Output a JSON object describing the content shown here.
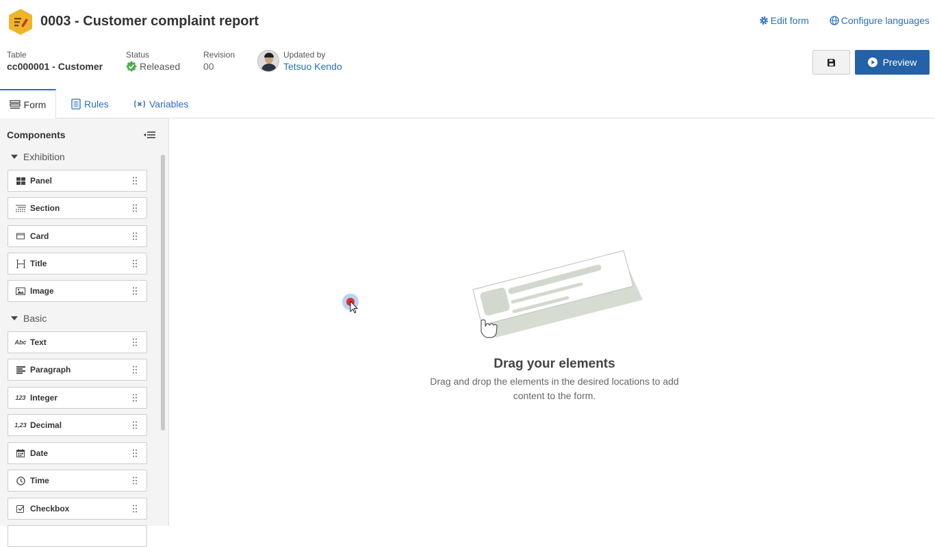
{
  "header": {
    "title": "0003 - Customer complaint report",
    "links": {
      "edit_form": "Edit form",
      "configure_languages": "Configure languages"
    },
    "meta": {
      "table_label": "Table",
      "table_value": "cc000001 - Customer",
      "status_label": "Status",
      "status_value": "Released",
      "revision_label": "Revision",
      "revision_value": "00",
      "updated_label": "Updated by",
      "updated_value": "Tetsuo Kendo"
    },
    "preview_label": "Preview",
    "colors": {
      "accent": "#2361a8",
      "status": "#4caf50",
      "app_icon": "#f0b429"
    }
  },
  "tabs": [
    {
      "label": "Form",
      "icon": "form-icon",
      "active": true
    },
    {
      "label": "Rules",
      "icon": "rules-icon"
    },
    {
      "label": "Variables",
      "icon": "variables-icon"
    }
  ],
  "sidebar": {
    "title": "Components",
    "groups": [
      {
        "label": "Exhibition",
        "items": [
          {
            "label": "Panel",
            "icon": "panel-icon"
          },
          {
            "label": "Section",
            "icon": "section-icon"
          },
          {
            "label": "Card",
            "icon": "card-icon"
          },
          {
            "label": "Title",
            "icon": "title-icon"
          },
          {
            "label": "Image",
            "icon": "image-icon"
          }
        ]
      },
      {
        "label": "Basic",
        "items": [
          {
            "label": "Text",
            "icon": "text-icon",
            "glyph": "Abc"
          },
          {
            "label": "Paragraph",
            "icon": "paragraph-icon"
          },
          {
            "label": "Integer",
            "icon": "integer-icon",
            "glyph": "123"
          },
          {
            "label": "Decimal",
            "icon": "decimal-icon",
            "glyph": "1,23"
          },
          {
            "label": "Date",
            "icon": "calendar-icon"
          },
          {
            "label": "Time",
            "icon": "clock-icon"
          },
          {
            "label": "Checkbox",
            "icon": "checkbox-icon"
          }
        ]
      }
    ]
  },
  "canvas": {
    "empty_title": "Drag your elements",
    "empty_description": "Drag and drop the elements in the desired locations to add content to the form."
  }
}
